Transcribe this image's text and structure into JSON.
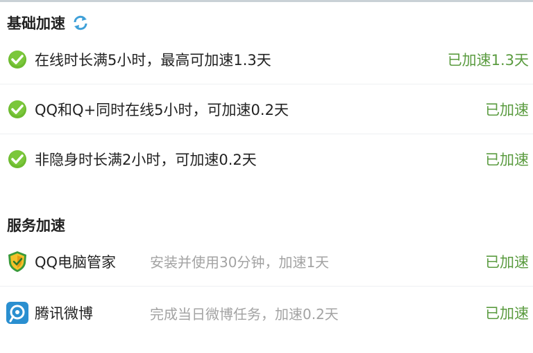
{
  "basic": {
    "title": "基础加速",
    "refresh_icon": "refresh-icon",
    "items": [
      {
        "icon": "check-icon",
        "text": "在线时长满5小时，最高可加速1.3天",
        "status": "已加速1.3天"
      },
      {
        "icon": "check-icon",
        "text": "QQ和Q+同时在线5小时，可加速0.2天",
        "status": "已加速"
      },
      {
        "icon": "check-icon",
        "text": "非隐身时长满2小时，可加速0.2天",
        "status": "已加速"
      }
    ]
  },
  "service": {
    "title": "服务加速",
    "items": [
      {
        "icon": "qq-pc-manager-icon",
        "name": "QQ电脑管家",
        "desc": "安装并使用30分钟，加速1天",
        "status": "已加速"
      },
      {
        "icon": "tencent-weibo-icon",
        "name": "腾讯微博",
        "desc": "完成当日微博任务，加速0.2天",
        "status": "已加速"
      }
    ]
  },
  "colors": {
    "status_green": "#5a9b3f",
    "check_green": "#6dbb2f",
    "refresh_blue": "#3fa0d8",
    "weibo_blue": "#2a8fd0",
    "muted_text": "#a3a3a3"
  }
}
